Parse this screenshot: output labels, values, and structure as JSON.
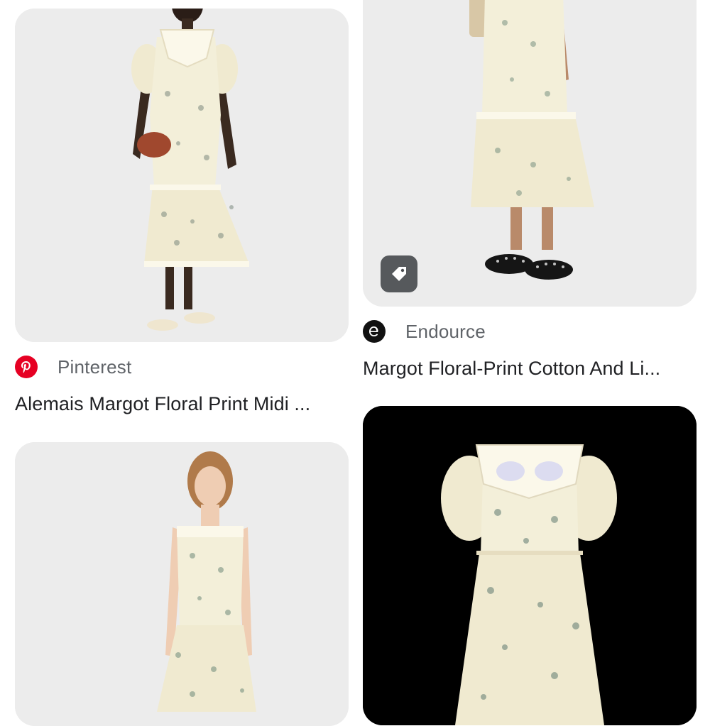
{
  "results": [
    {
      "source_name": "Pinterest",
      "source_icon": "pinterest-logo-icon",
      "title": "Alemais Margot Floral Print Midi ..."
    },
    {
      "source_name": "Endource",
      "source_icon": "endource-logo-icon",
      "title": "Margot Floral-Print Cotton And Li..."
    },
    {
      "source_name": "",
      "title": ""
    },
    {
      "source_name": "",
      "title": ""
    }
  ],
  "badges": {
    "shopping_tag_icon": "price-tag-icon"
  },
  "colors": {
    "pinterest_red": "#e60023",
    "card_gray": "#ececec",
    "dress_cream": "#f3efd9"
  }
}
